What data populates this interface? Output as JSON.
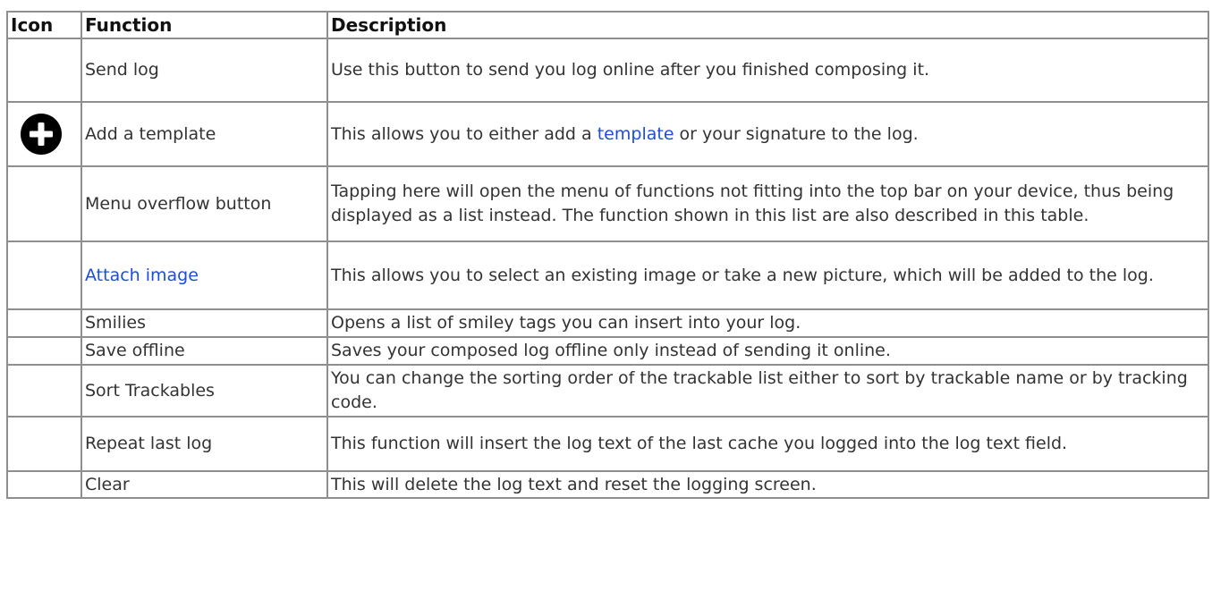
{
  "table": {
    "headers": {
      "icon": "Icon",
      "function": "Function",
      "description": "Description"
    },
    "rows": [
      {
        "icon": "",
        "function": "Send log",
        "description": "Use this button to send you log online after you finished composing it."
      },
      {
        "icon": "plus-circle-icon",
        "function": "Add a template",
        "description_before": "This allows you to either add a ",
        "description_link": "template",
        "description_after": " or your signature to the log."
      },
      {
        "icon": "",
        "function": "Menu overflow button",
        "description": "Tapping here will open the menu of functions not fitting into the top bar on your device, thus being displayed as a list instead. The function shown in this list are also described in this table."
      },
      {
        "icon": "",
        "function_link": "Attach image",
        "description": "This allows you to select an existing image or take a new picture, which will be added to the log."
      },
      {
        "icon": "",
        "function": "Smilies",
        "description": "Opens a list of smiley tags you can insert into your log."
      },
      {
        "icon": "",
        "function": "Save offline",
        "description": "Saves your composed log offline only instead of sending it online."
      },
      {
        "icon": "",
        "function": "Sort Trackables",
        "description": "You can change the sorting order of the trackable list either to sort by trackable name or by tracking code."
      },
      {
        "icon": "",
        "function": "Repeat last log",
        "description": "This function will insert the log text of the last cache you logged into the log text field."
      },
      {
        "icon": "",
        "function": "Clear",
        "description": "This will delete the log text and reset the logging screen."
      }
    ]
  },
  "colors": {
    "border": "#8e8e8e",
    "link": "#1d4ed8",
    "text": "#333333",
    "icon": "#000000"
  }
}
